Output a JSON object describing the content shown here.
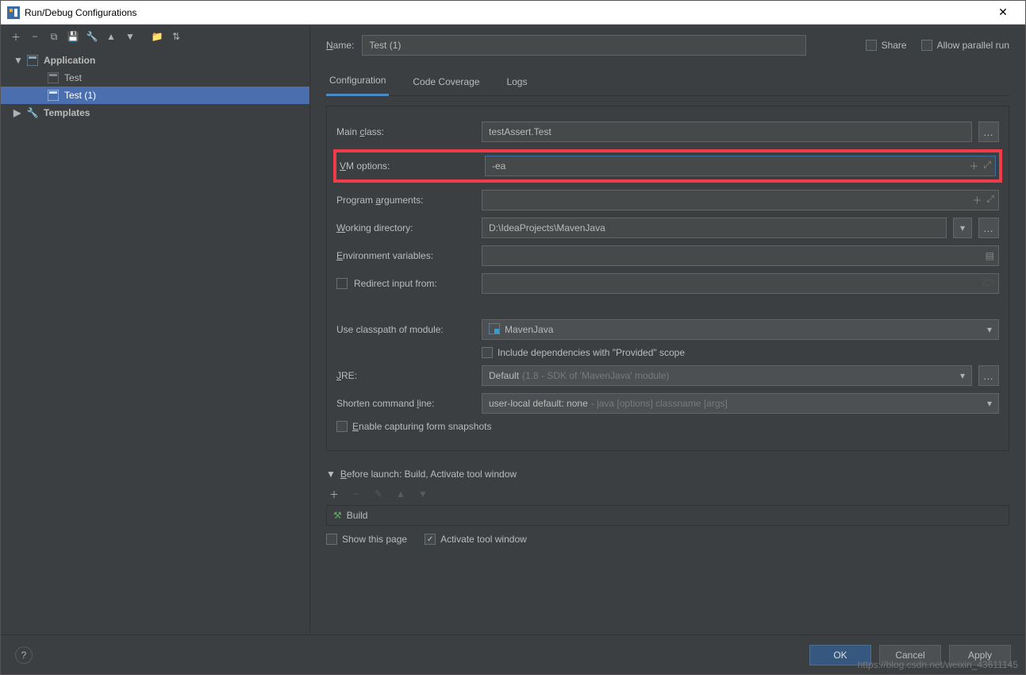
{
  "window": {
    "title": "Run/Debug Configurations"
  },
  "sidebar": {
    "items": [
      {
        "label": "Application",
        "children": [
          {
            "label": "Test"
          },
          {
            "label": "Test (1)",
            "selected": true
          }
        ]
      },
      {
        "label": "Templates"
      }
    ]
  },
  "name_field": {
    "label": "Name:",
    "value": "Test (1)"
  },
  "share": {
    "label": "Share"
  },
  "parallel": {
    "label": "Allow parallel run"
  },
  "tabs": {
    "items": [
      "Configuration",
      "Code Coverage",
      "Logs"
    ],
    "active": 0
  },
  "config": {
    "main_class": {
      "label_pre": "Main ",
      "label_u": "c",
      "label_post": "lass:",
      "value": "testAssert.Test"
    },
    "vm_options": {
      "label_u": "V",
      "label_post": "M options:",
      "value": "-ea"
    },
    "program_args": {
      "label_pre": "Program ",
      "label_u": "a",
      "label_post": "rguments:",
      "value": ""
    },
    "working_dir": {
      "label_u": "W",
      "label_post": "orking directory:",
      "value": "D:\\IdeaProjects\\MavenJava"
    },
    "env_vars": {
      "label_u": "E",
      "label_post": "nvironment variables:",
      "value": ""
    },
    "redirect_input": {
      "label": "Redirect input from:",
      "value": ""
    },
    "classpath_module": {
      "label": "Use classpath of module:",
      "value": "MavenJava"
    },
    "include_provided": {
      "label": "Include dependencies with \"Provided\" scope"
    },
    "jre": {
      "label_u": "J",
      "label_post": "RE:",
      "value": "Default",
      "hint": "(1.8 - SDK of 'MavenJava' module)"
    },
    "shorten": {
      "label_pre": "Shorten command ",
      "label_u": "l",
      "label_post": "ine:",
      "value": "user-local default: none",
      "hint": "- java [options] classname [args]"
    },
    "enable_snapshots": {
      "label_u": "E",
      "label_post": "nable capturing form snapshots"
    }
  },
  "before_launch": {
    "header_u": "B",
    "header_post": "efore launch: Build, Activate tool window",
    "items": [
      "Build"
    ],
    "show_page": {
      "label": "Show this page"
    },
    "activate_tool": {
      "label": "Activate tool window",
      "checked": true
    }
  },
  "buttons": {
    "ok": "OK",
    "cancel": "Cancel",
    "apply": "Apply"
  },
  "watermark": "https://blog.csdn.net/weixin_43611145"
}
